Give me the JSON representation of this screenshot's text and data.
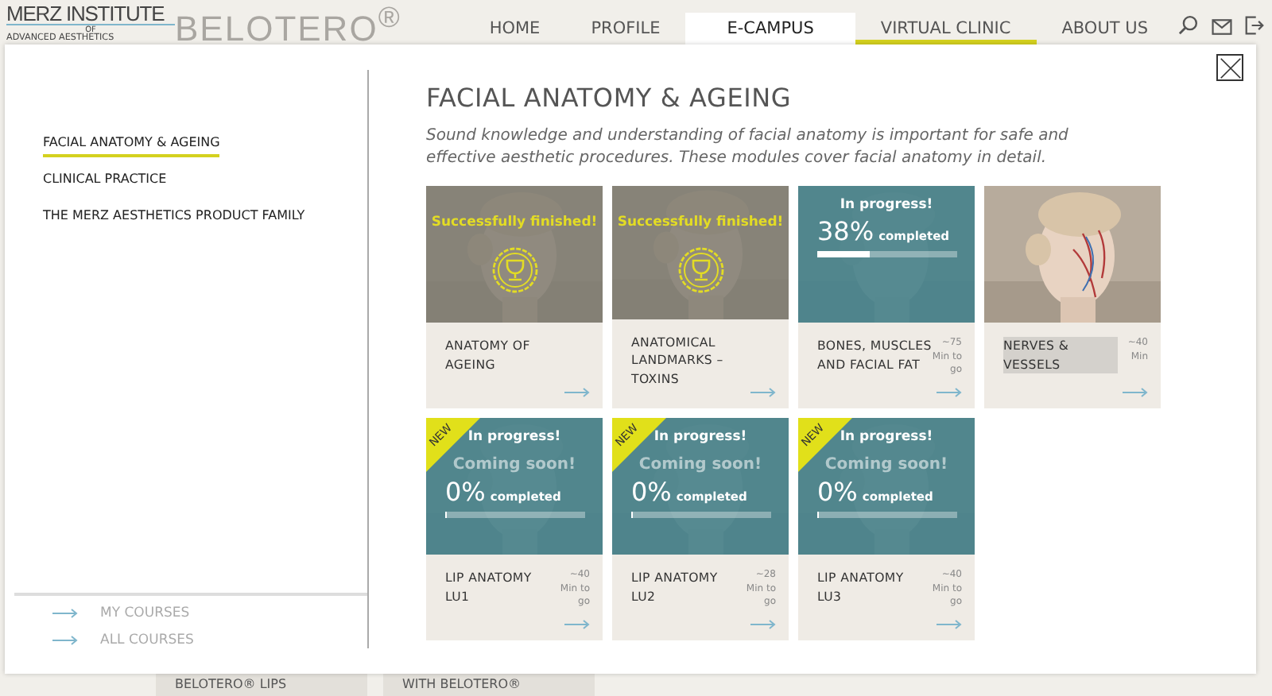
{
  "logo": {
    "name": "MERZ INSTITUTE",
    "of": "OF",
    "subtitle": "ADVANCED AESTHETICS"
  },
  "brand": "BELOTERO$^{®}$",
  "nav": [
    {
      "label": "HOME",
      "selected": false,
      "highlighted": false
    },
    {
      "label": "PROFILE",
      "selected": false,
      "highlighted": false
    },
    {
      "label": "E-CAMPUS",
      "selected": true,
      "highlighted": false
    },
    {
      "label": "VIRTUAL CLINIC",
      "selected": false,
      "highlighted": true
    },
    {
      "label": "ABOUT US",
      "selected": false,
      "highlighted": false
    }
  ],
  "sidebar": {
    "items": [
      {
        "label": "FACIAL ANATOMY & AGEING",
        "selected": true
      },
      {
        "label": "CLINICAL PRACTICE",
        "selected": false
      },
      {
        "label": "THE MERZ AESTHETICS PRODUCT FAMILY",
        "selected": false
      }
    ],
    "links": [
      "MY COURSES",
      "ALL COURSES"
    ]
  },
  "content": {
    "title": "FACIAL ANATOMY & AGEING",
    "intro": "Sound knowledge and understanding of facial anatomy is important for safe and effective aesthetic procedures. These modules cover facial anatomy in detail."
  },
  "modules": [
    {
      "kind": "finished",
      "status": "Successfully finished!",
      "title": "ANATOMY OF AGEING",
      "highlighted": false
    },
    {
      "kind": "finished",
      "status": "Successfully finished!",
      "title": "ANATOMICAL LANDMARKS – TOXINS",
      "highlighted": false
    },
    {
      "kind": "progress",
      "status": "In progress!",
      "percent": "38%",
      "completed": "completed",
      "level": 0.38,
      "title": "BONES, MUSCLES AND FACIAL FAT",
      "duration": [
        "~75",
        "Min to",
        "go"
      ],
      "highlighted": false
    },
    {
      "title": "NERVES & VESSELS",
      "duration": [
        "~40",
        "Min"
      ],
      "highlighted": true
    },
    {
      "kind": "progress",
      "badge": "NEW",
      "status": "In progress!",
      "note": "Coming soon!",
      "percent": "0%",
      "completed": "completed",
      "level": 0,
      "title": "LIP ANATOMY LU1",
      "duration": [
        "~40",
        "Min to",
        "go"
      ],
      "highlighted": false
    },
    {
      "kind": "progress",
      "badge": "NEW",
      "status": "In progress!",
      "note": "Coming soon!",
      "percent": "0%",
      "completed": "completed",
      "level": 0,
      "title": "LIP ANATOMY LU2",
      "duration": [
        "~28",
        "Min to",
        "go"
      ],
      "highlighted": false
    },
    {
      "kind": "progress",
      "badge": "NEW",
      "status": "In progress!",
      "note": "Coming soon!",
      "percent": "0%",
      "completed": "completed",
      "level": 0,
      "title": "LIP ANATOMY LU3",
      "duration": [
        "~40",
        "Min to",
        "go"
      ],
      "highlighted": false
    }
  ],
  "background_cards": [
    "BELOTERO® LIPS",
    "WITH BELOTERO®"
  ]
}
